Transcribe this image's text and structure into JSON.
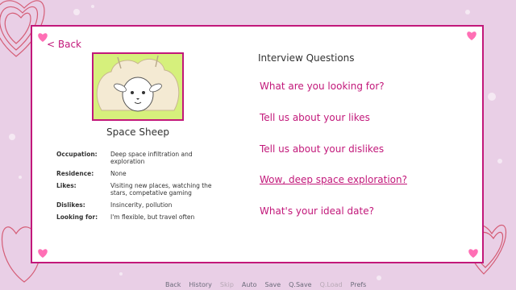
{
  "back_label": "< Back",
  "profile": {
    "name": "Space Sheep",
    "facts": [
      {
        "label": "Occupation:",
        "value": "Deep space infiltration and exploration"
      },
      {
        "label": "Residence:",
        "value": "None"
      },
      {
        "label": "Likes:",
        "value": "Visiting new places, watching the stars, competative gaming"
      },
      {
        "label": "Dislikes:",
        "value": "Insincerity, pollution"
      },
      {
        "label": "Looking for:",
        "value": "I'm flexible, but travel often"
      }
    ]
  },
  "interview": {
    "title": "Interview Questions",
    "questions": [
      "What are you looking for?",
      "Tell us about your likes",
      "Tell us about your dislikes",
      "Wow, deep space exploration?",
      "What's your ideal date?"
    ]
  },
  "quick_menu": [
    "Back",
    "History",
    "Skip",
    "Auto",
    "Save",
    "Q.Save",
    "Q.Load",
    "Prefs"
  ],
  "colors": {
    "accent": "#c2187a",
    "portrait_bg": "#d6f07c",
    "page_bg": "#e9cfe6"
  }
}
